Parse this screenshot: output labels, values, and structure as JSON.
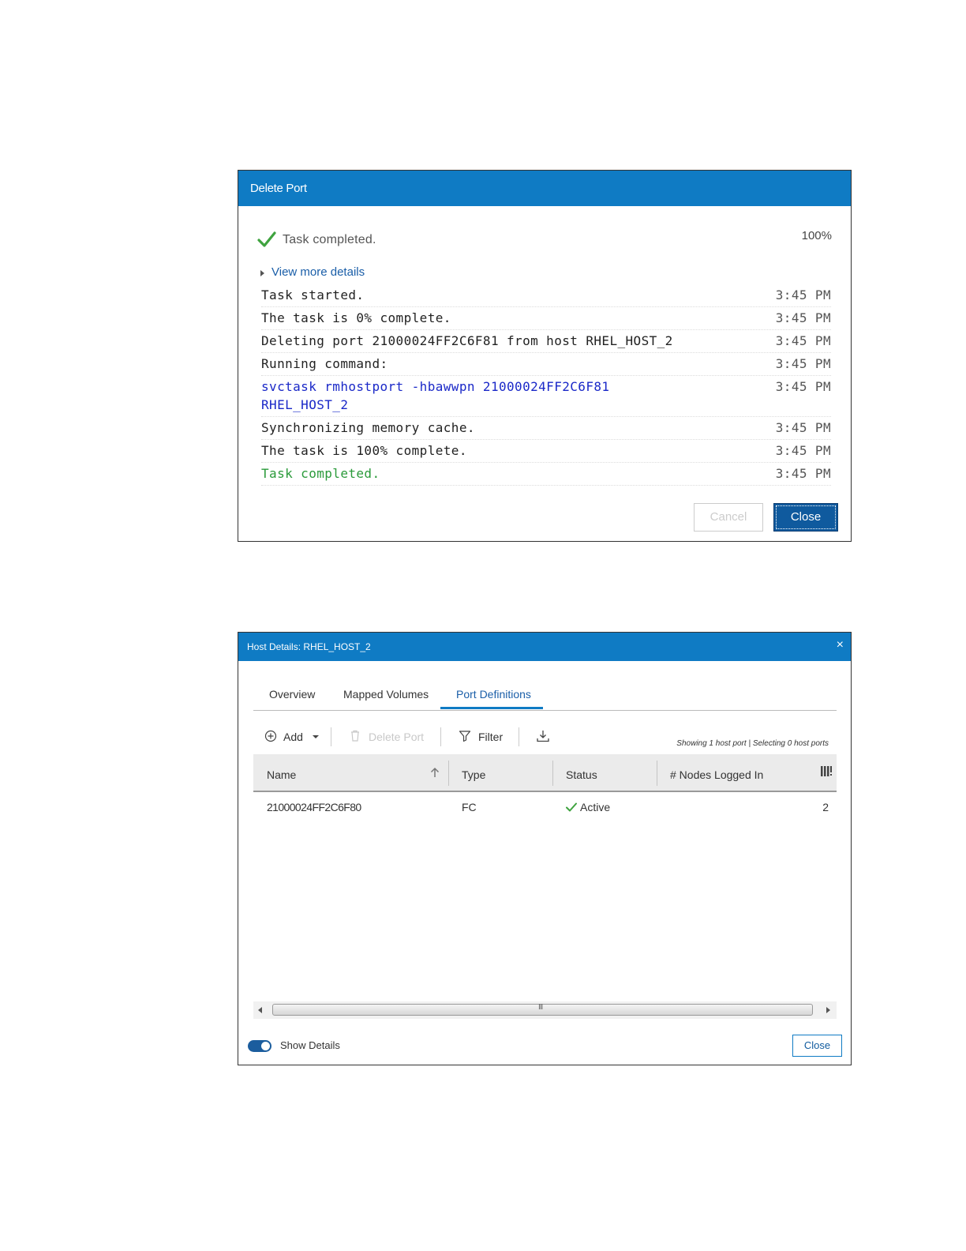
{
  "delete_dialog": {
    "title": "Delete Port",
    "status_text": "Task completed.",
    "percent": "100%",
    "more_details": "View more details",
    "log": [
      {
        "msg": "Task started.",
        "time": "3:45 PM"
      },
      {
        "msg": "The task is 0% complete.",
        "time": "3:45 PM"
      },
      {
        "msg": "Deleting port 21000024FF2C6F81 from host RHEL_HOST_2",
        "time": "3:45 PM"
      },
      {
        "msg": "Running command:",
        "time": "3:45 PM"
      },
      {
        "msg": "svctask rmhostport -hbawwpn 21000024FF2C6F81\nRHEL_HOST_2",
        "time": "3:45 PM"
      },
      {
        "msg": "Synchronizing memory cache.",
        "time": "3:45 PM"
      },
      {
        "msg": "The task is 100% complete.",
        "time": "3:45 PM"
      },
      {
        "msg": "Task completed.",
        "time": "3:45 PM"
      }
    ],
    "cancel_label": "Cancel",
    "close_label": "Close",
    "colors": {
      "titlebar": "#0f7bc4",
      "command": "#1a28c8",
      "success": "#2a9a3a"
    }
  },
  "host_dialog": {
    "title": "Host Details: RHEL_HOST_2",
    "close_x": "×",
    "tabs": [
      "Overview",
      "Mapped Volumes",
      "Port Definitions"
    ],
    "active_tab": "Port Definitions",
    "toolbar": {
      "add": "Add",
      "delete_port": "Delete Port",
      "filter": "Filter",
      "showing": "Showing 1 host port | Selecting 0 host ports"
    },
    "columns": [
      "Name",
      "Type",
      "Status",
      "# Nodes Logged In"
    ],
    "rows": [
      {
        "name": "21000024FF2C6F80",
        "type": "FC",
        "status": "Active",
        "nodes": "2"
      }
    ],
    "scroll_grip": "III",
    "show_details": "Show Details",
    "close_label": "Close"
  }
}
